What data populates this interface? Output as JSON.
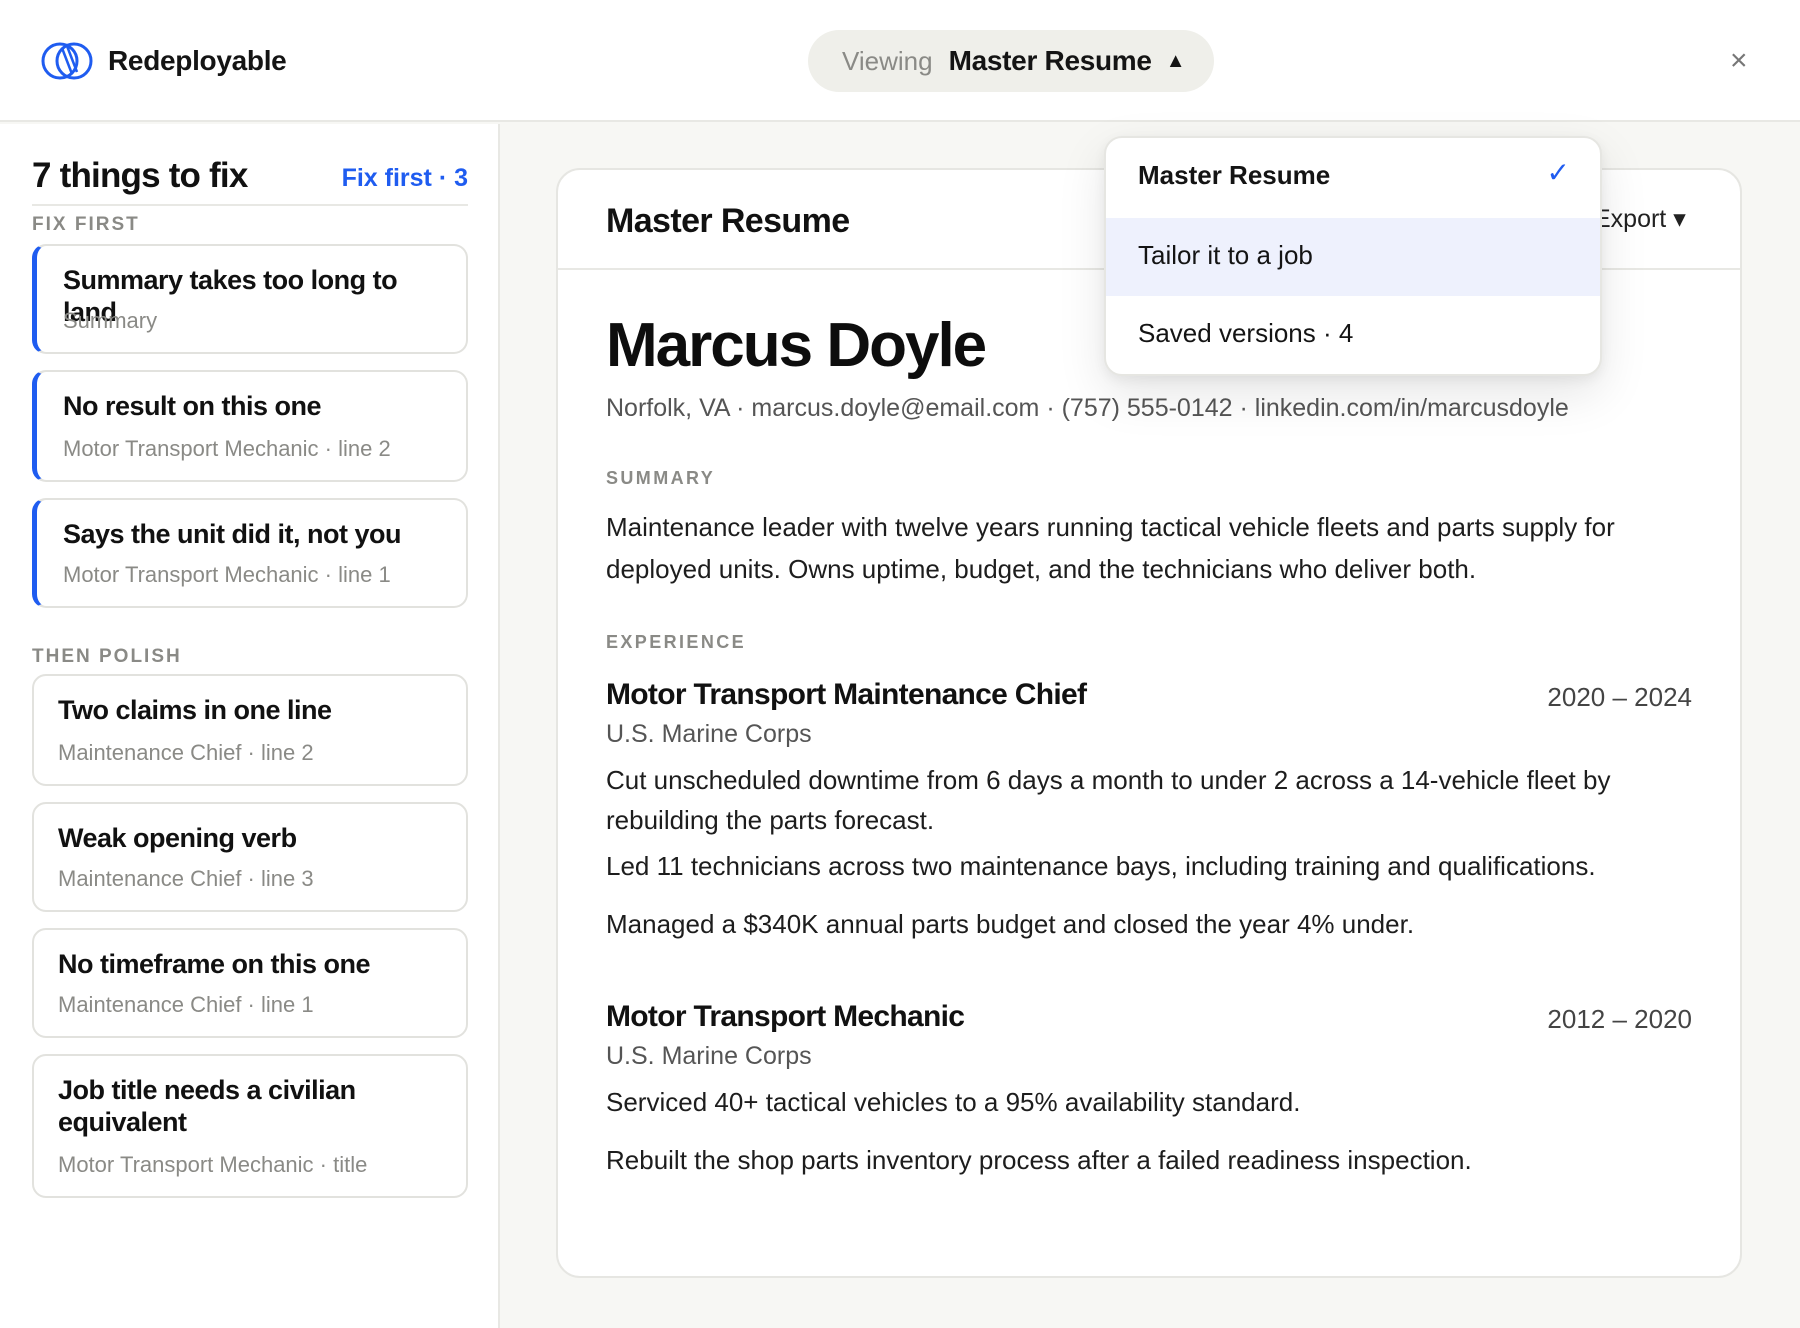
{
  "brand": {
    "name": "Redeployable",
    "accent": "#1f5cf0"
  },
  "header": {
    "viewing_label": "Viewing",
    "viewing_value": "Master Resume",
    "close_glyph": "×"
  },
  "sidebar": {
    "title": "7 things to fix",
    "fix_first_link": "Fix first · 3",
    "fix_first_label": "FIX FIRST",
    "then_polish_label": "THEN POLISH",
    "fix_first_items": [
      {
        "title": "Summary takes too long to land",
        "sub": "Summary"
      },
      {
        "title": "No result on this one",
        "sub": "Motor Transport Mechanic · line 2"
      },
      {
        "title": "Says the unit did it, not you",
        "sub": "Motor Transport Mechanic · line 1"
      }
    ],
    "polish_items": [
      {
        "title": "Two claims in one line",
        "sub": "Maintenance Chief · line 2"
      },
      {
        "title": "Weak opening verb",
        "sub": "Maintenance Chief · line 3"
      },
      {
        "title": "No timeframe on this one",
        "sub": "Maintenance Chief · line 1"
      },
      {
        "title": "Job title needs a civilian equivalent",
        "sub": "Motor Transport Mechanic · title"
      }
    ]
  },
  "resume": {
    "doc_title": "Master Resume",
    "export_label": "Export ▾",
    "name": "Marcus Doyle",
    "contact": "Norfolk, VA · marcus.doyle@email.com · (757) 555-0142 · linkedin.com/in/marcusdoyle",
    "summary_label": "SUMMARY",
    "summary": "Maintenance leader with twelve years running tactical vehicle fleets and parts supply for deployed units. Owns uptime, budget, and the technicians who deliver both.",
    "experience_label": "EXPERIENCE",
    "jobs": [
      {
        "title": "Motor Transport Maintenance Chief",
        "dates": "2020 – 2024",
        "org": "U.S. Marine Corps",
        "bullets": [
          "Cut unscheduled downtime from 6 days a month to under 2 across a 14-vehicle fleet by rebuilding the parts forecast.",
          "Led 11 technicians across two maintenance bays, including training and qualifications.",
          "Managed a $340K annual parts budget and closed the year 4% under."
        ]
      },
      {
        "title": "Motor Transport Mechanic",
        "dates": "2012 – 2020",
        "org": "U.S. Marine Corps",
        "bullets": [
          "Serviced 40+ tactical vehicles to a 95% availability standard.",
          "Rebuilt the shop parts inventory process after a failed readiness inspection."
        ]
      }
    ]
  },
  "dropdown": {
    "items": [
      {
        "label": "Master Resume",
        "selected": true
      },
      {
        "label": "Tailor it to a job",
        "highlighted": true
      },
      {
        "label": "Saved versions · 4"
      }
    ],
    "check_glyph": "✓"
  }
}
